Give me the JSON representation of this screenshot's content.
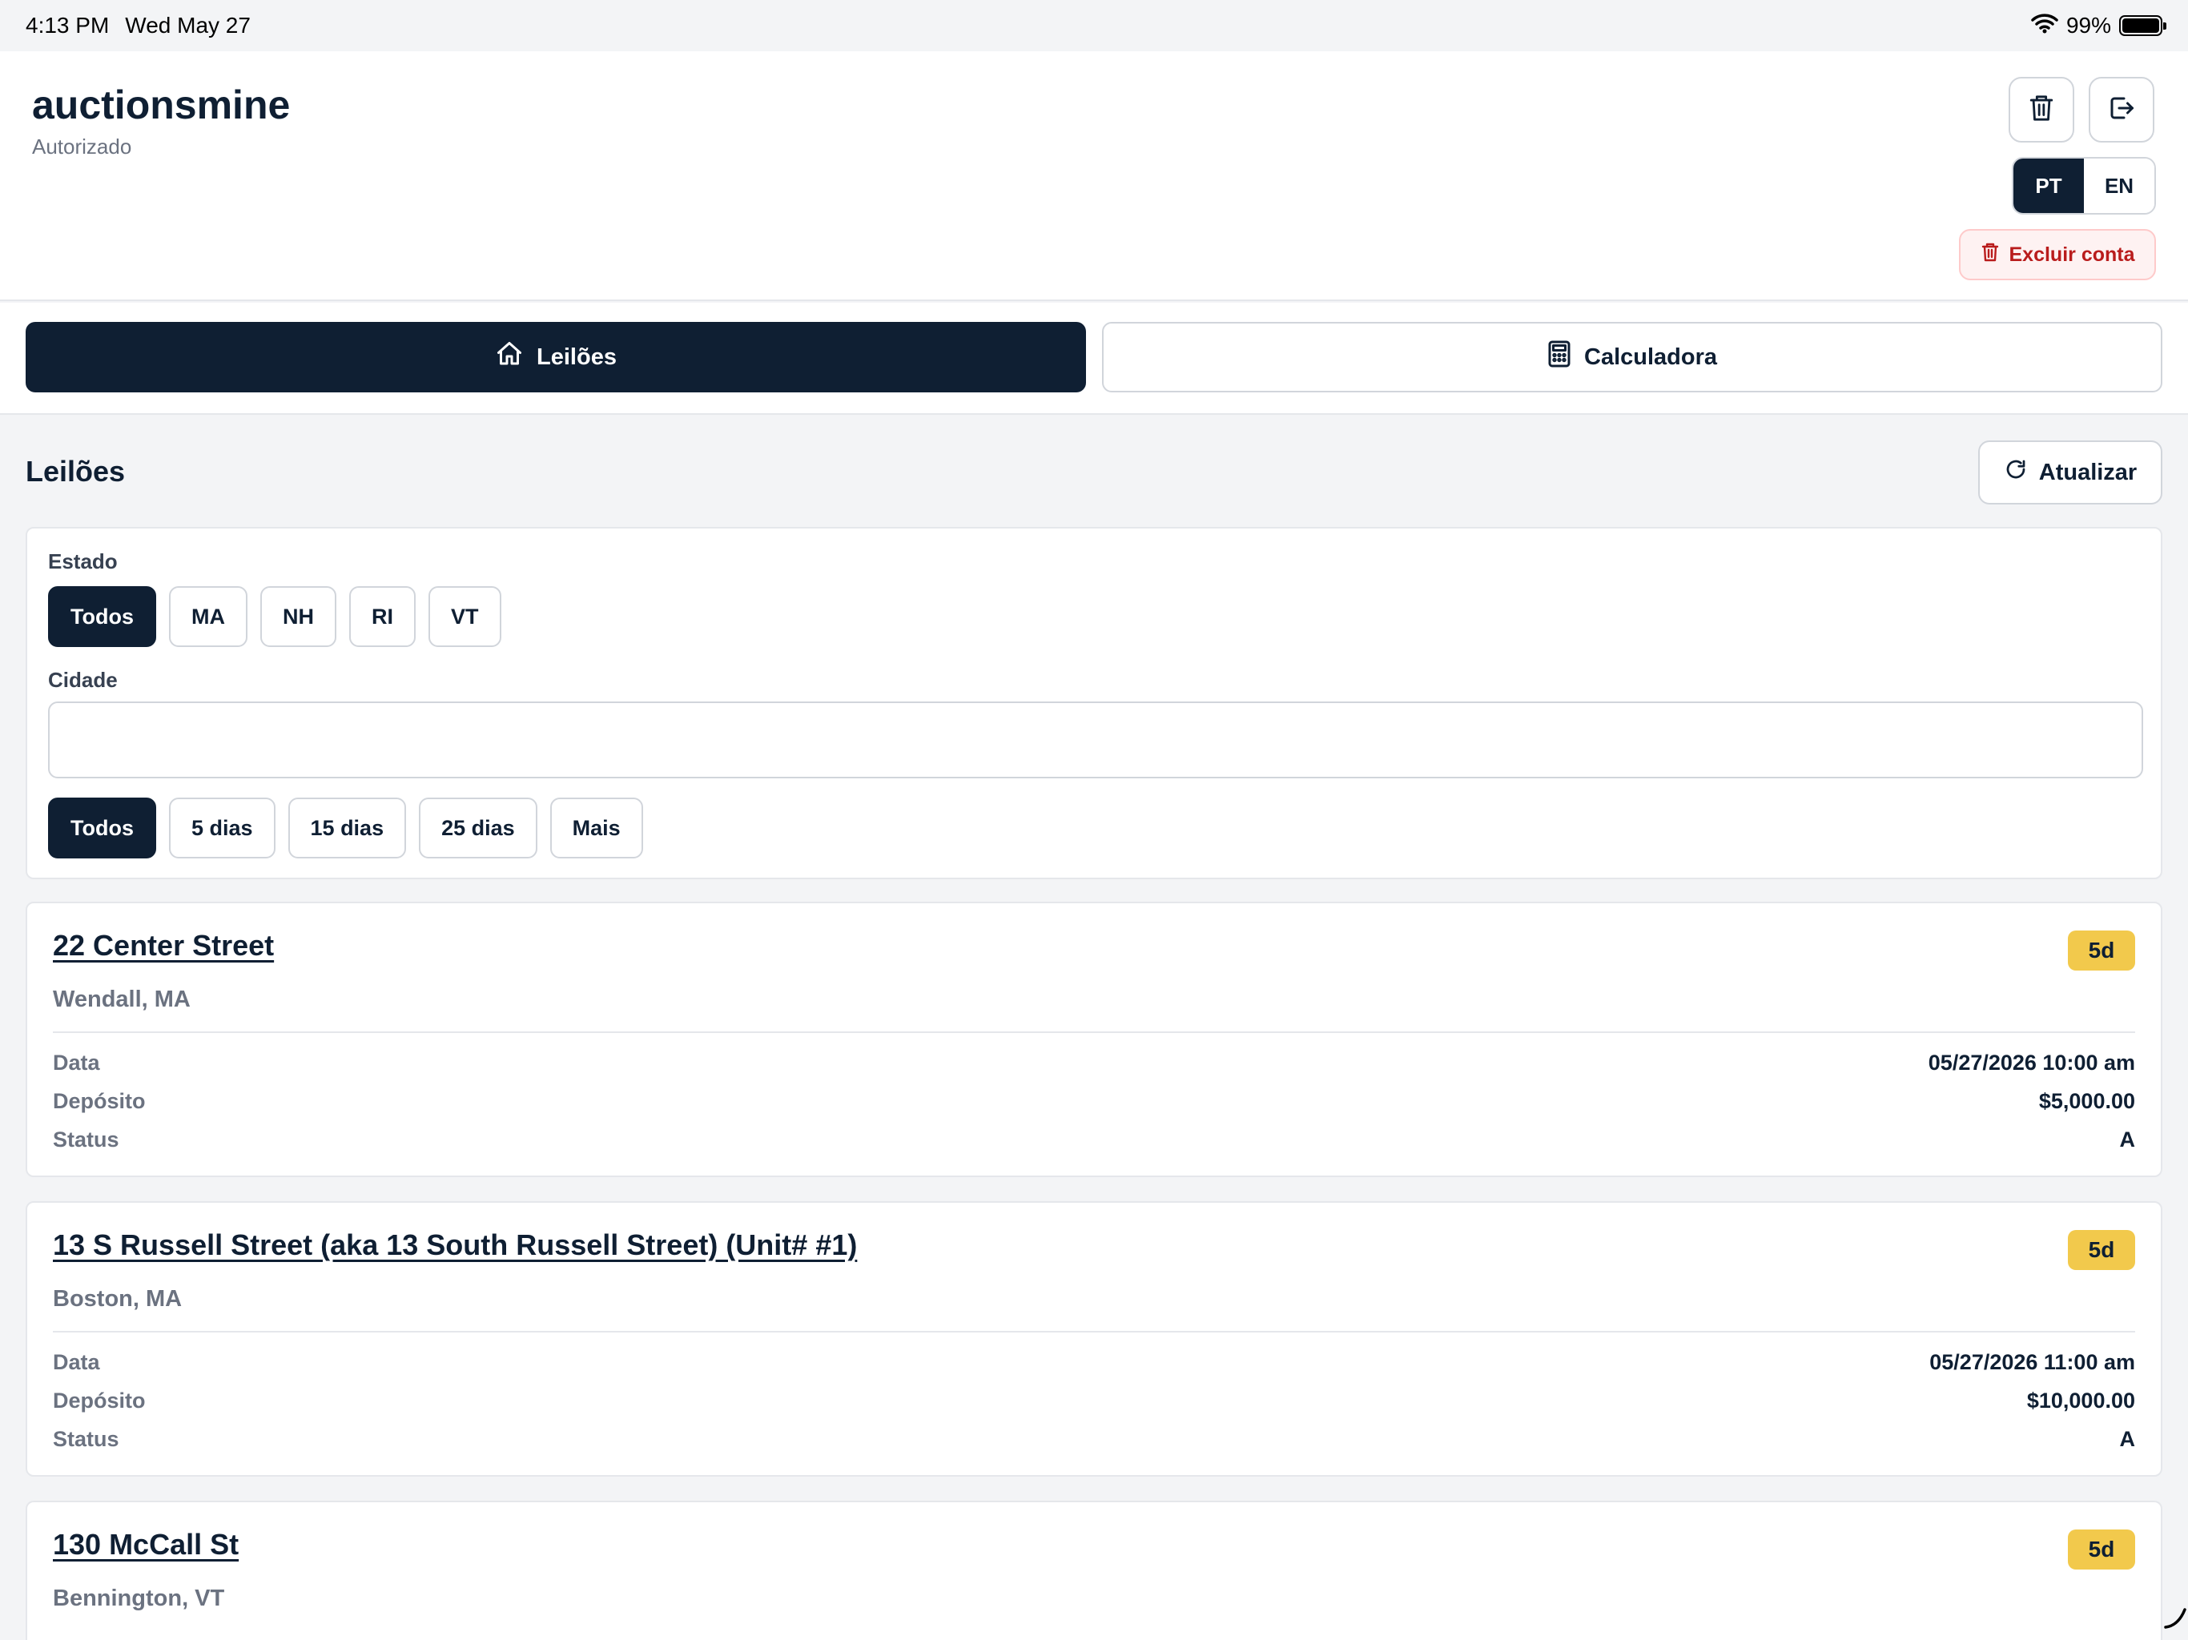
{
  "status_bar": {
    "time": "4:13 PM",
    "date": "Wed May 27",
    "battery": "99%"
  },
  "header": {
    "app_title": "auctionsmine",
    "subtitle": "Autorizado",
    "lang_pt": "PT",
    "lang_en": "EN",
    "active_lang": "PT",
    "delete_account_label": "Excluir conta"
  },
  "tabs": [
    {
      "label": "Leilões",
      "icon": "home-icon",
      "active": true
    },
    {
      "label": "Calculadora",
      "icon": "calculator-icon",
      "active": false
    }
  ],
  "main": {
    "section_title": "Leilões",
    "refresh_label": "Atualizar"
  },
  "filters": {
    "state_label": "Estado",
    "states": [
      "Todos",
      "MA",
      "NH",
      "RI",
      "VT"
    ],
    "selected_state": "Todos",
    "city_label": "Cidade",
    "city_value": "",
    "city_placeholder": "",
    "periods": [
      "Todos",
      "5 dias",
      "15 dias",
      "25 dias",
      "Mais"
    ],
    "selected_period": "Todos"
  },
  "auctions": [
    {
      "title": "22 Center Street",
      "location": "Wendall, MA",
      "badge": "5d",
      "date_label": "Data",
      "date": "05/27/2026 10:00 am",
      "deposit_label": "Depósito",
      "deposit": "$5,000.00",
      "status_label": "Status",
      "status": "A"
    },
    {
      "title": "13 S Russell Street  (aka 13 South Russell Street) (Unit# #1)",
      "location": "Boston, MA",
      "badge": "5d",
      "date_label": "Data",
      "date": "05/27/2026 11:00 am",
      "deposit_label": "Depósito",
      "deposit": "$10,000.00",
      "status_label": "Status",
      "status": "A"
    },
    {
      "title": "130 McCall St",
      "location": "Bennington, VT",
      "badge": "5d"
    }
  ],
  "colors": {
    "primary": "#0f1f33",
    "badge": "#f2c94c",
    "danger": "#b91c1c",
    "danger_bg": "#fef2f2",
    "muted": "#6b7280",
    "background": "#f3f4f6"
  }
}
